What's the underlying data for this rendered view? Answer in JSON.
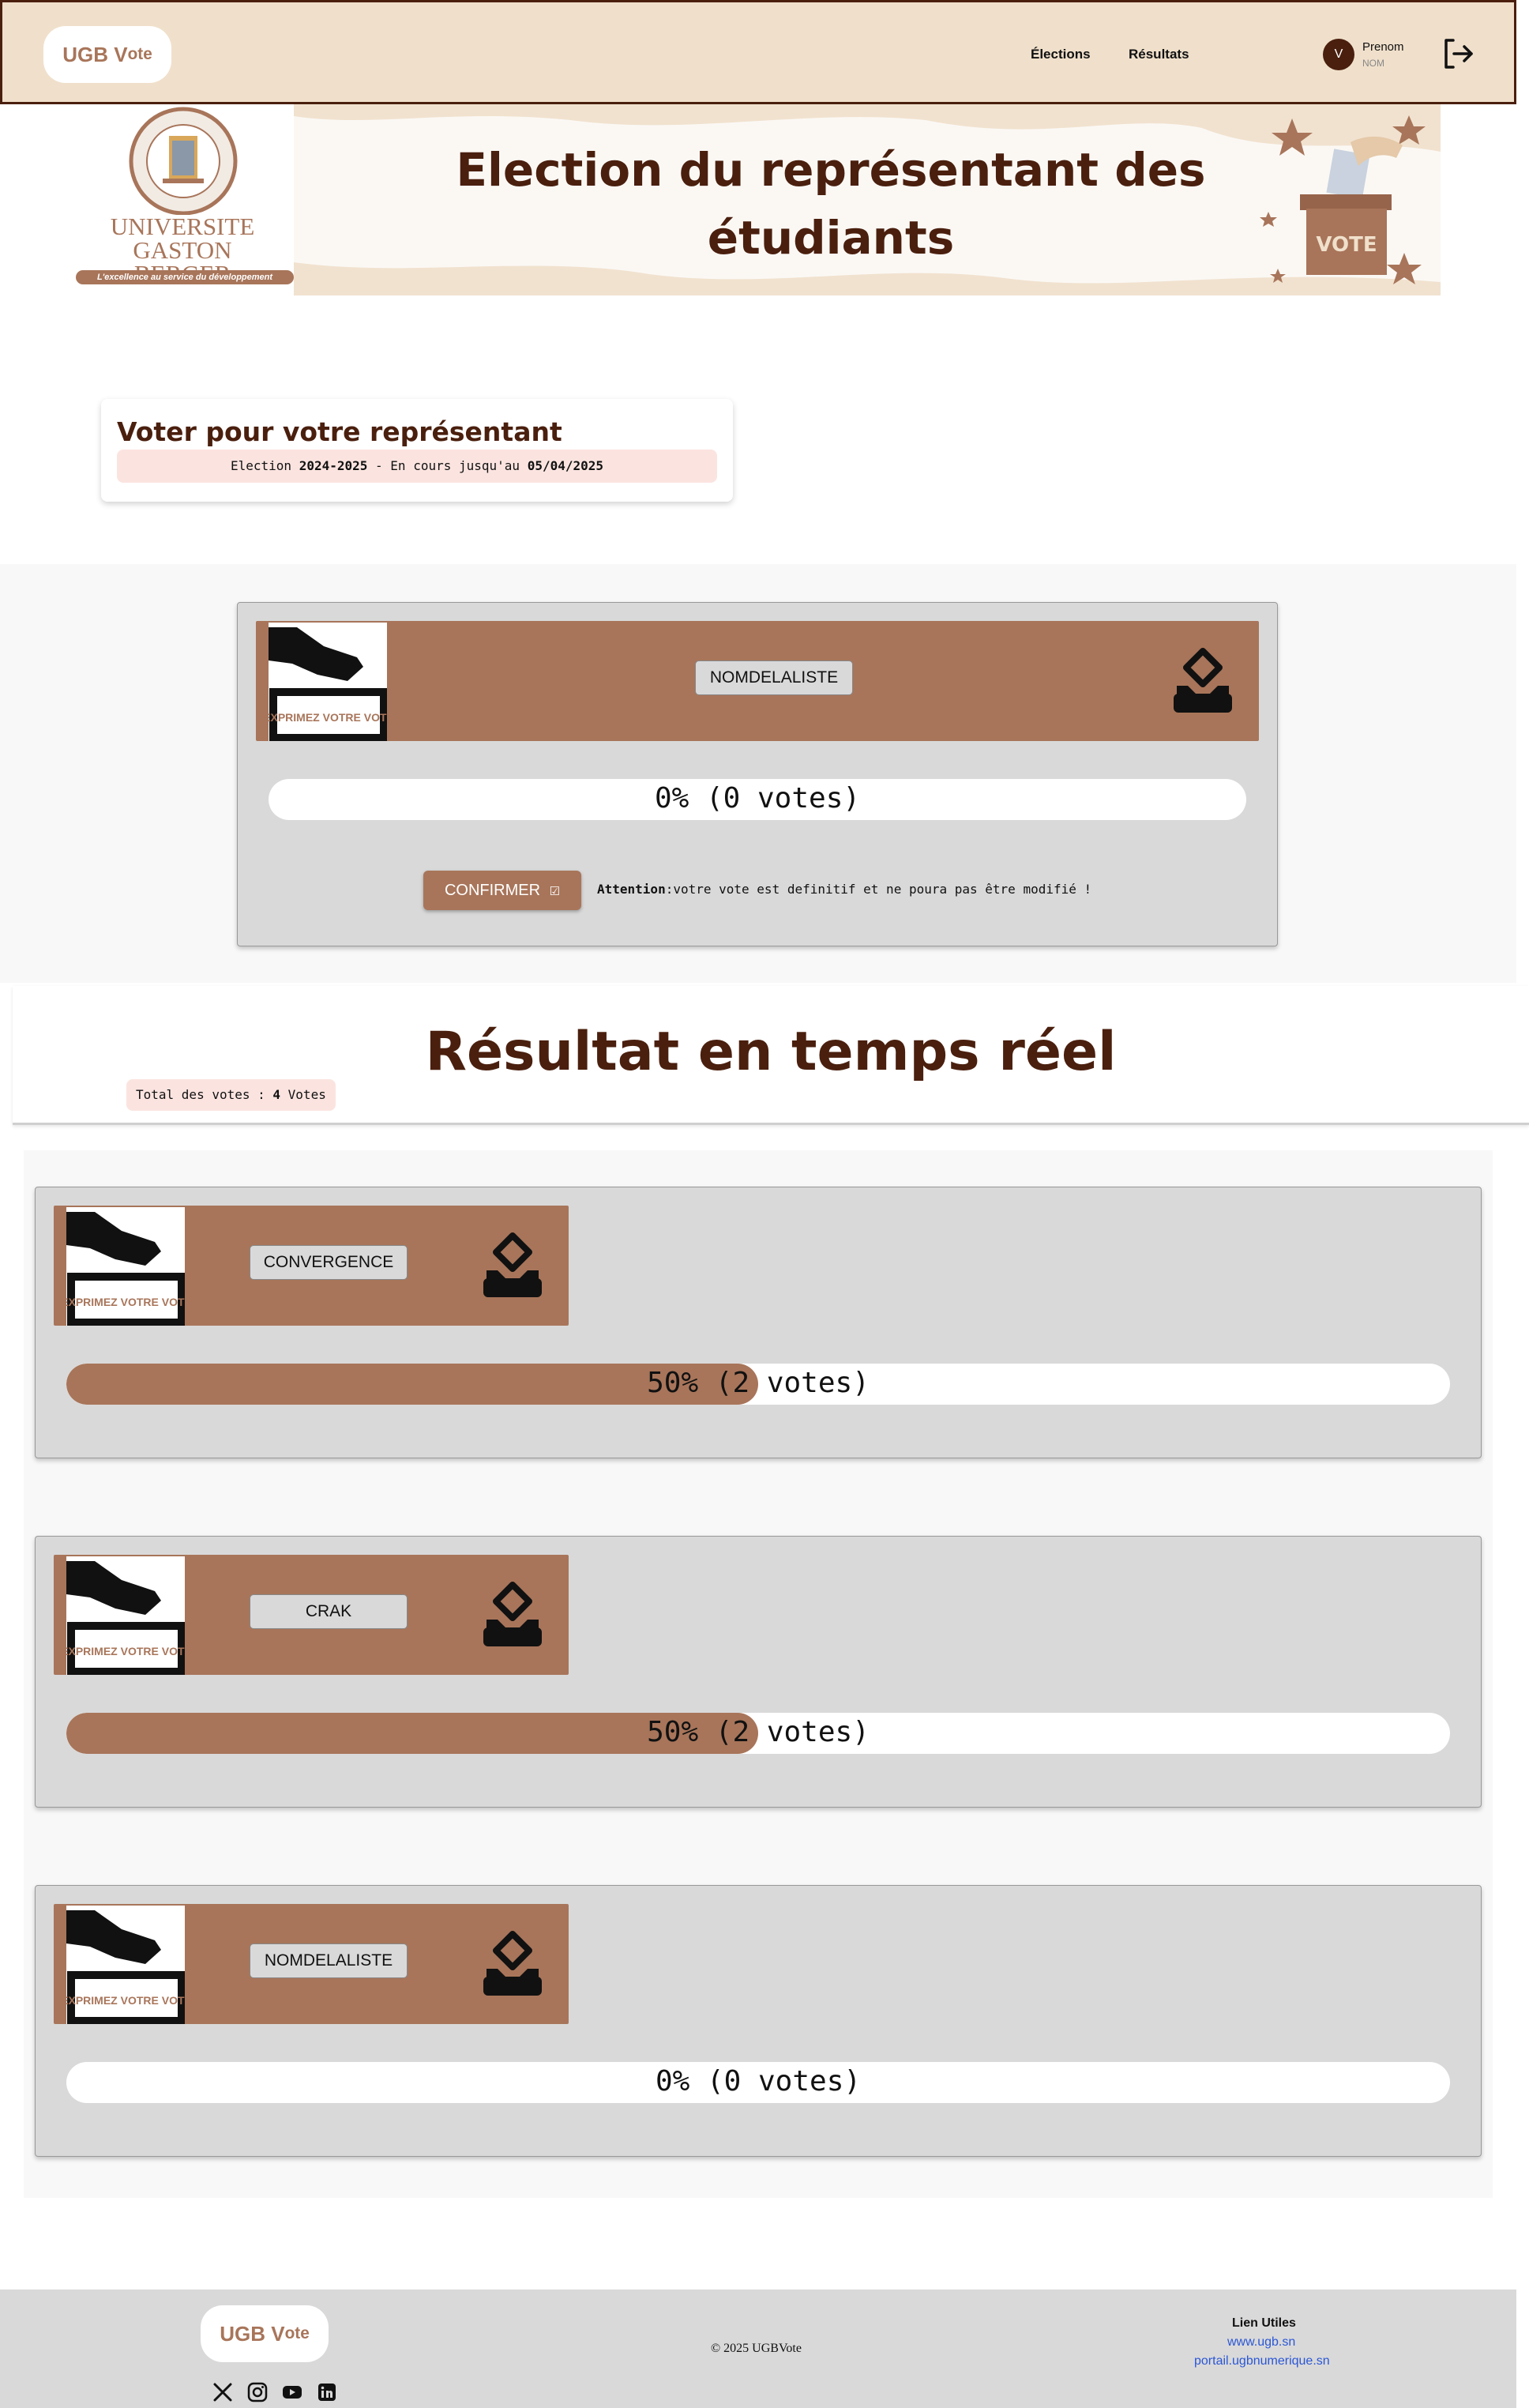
{
  "brand": {
    "name_main": "UGB V",
    "name_o": "o",
    "name_end": "te"
  },
  "nav": {
    "elections": "Élections",
    "results": "Résultats"
  },
  "user": {
    "initial": "V",
    "first_name": "Prenom",
    "last_name": "NOM"
  },
  "banner": {
    "title": "Election du représentant des étudiants",
    "university": "UNIVERSITE GASTON BERGER",
    "university_tagline": "L'excellence au service du développement",
    "vote_box_label": "VOTE"
  },
  "vote_card": {
    "title": "Voter pour votre représentant",
    "election_prefix": "Election ",
    "election_year": "2024-2025",
    "election_middle": " - En cours jusqu'au ",
    "election_end": "05/04/2025"
  },
  "ballot": {
    "thumb_caption": "EXPRIMEZ VOTRE VOTE",
    "list_name": "NOMDELALISTE",
    "progress_text": "0% (0 votes)",
    "progress_fraction": 0,
    "confirm_label": "CONFIRMER",
    "attention_label": "Attention",
    "attention_text": ":votre vote est definitif et ne poura pas être modifié !"
  },
  "results": {
    "title": "Résultat en temps réel",
    "total_prefix": "Total des votes : ",
    "total_count": "4",
    "total_suffix": " Votes",
    "thumb_caption": "EXPRIMEZ VOTRE VOTE",
    "lists": [
      {
        "name": "CONVERGENCE",
        "progress_text": "50% (2 votes)",
        "fraction": 0.5
      },
      {
        "name": "CRAK",
        "progress_text": "50% (2 votes)",
        "fraction": 0.5
      },
      {
        "name": "NOMDELALISTE",
        "progress_text": "0% (0 votes)",
        "fraction": 0
      }
    ]
  },
  "footer": {
    "copyright": "© 2025 UGBVote",
    "links_title": "Lien Utiles",
    "link1": "www.ugb.sn",
    "link2": "portail.ugbnumerique.sn",
    "socials": [
      "x-icon",
      "instagram-icon",
      "youtube-icon",
      "linkedin-icon"
    ]
  },
  "colors": {
    "accent": "#a8755a",
    "dark_brown": "#4a1f0e",
    "header_bg": "#f0e0cb",
    "panel_bg": "#d9d9d9",
    "info_pink": "#fbe4e0"
  }
}
